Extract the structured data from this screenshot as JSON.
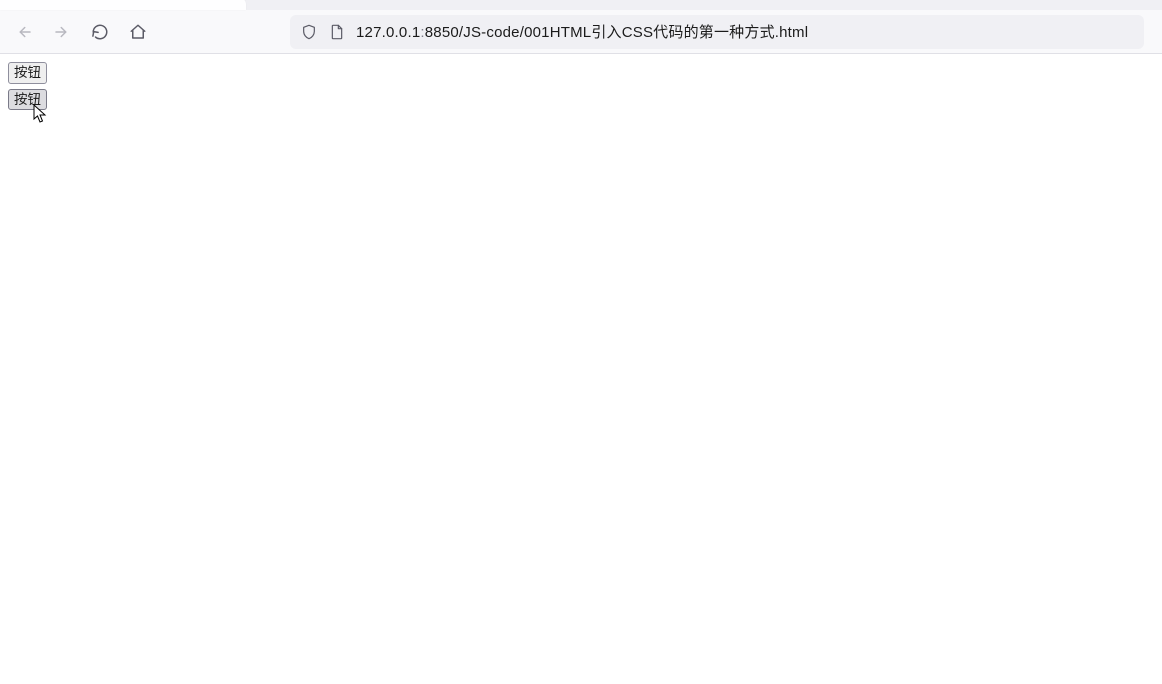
{
  "url_bar": {
    "host": "127.0.0.1",
    "sep": ":",
    "port_path": "8850/JS-code/001HTML引入CSS代码的第一种方式.html"
  },
  "page": {
    "button1_label": "按钮",
    "button2_label": "按钮"
  }
}
